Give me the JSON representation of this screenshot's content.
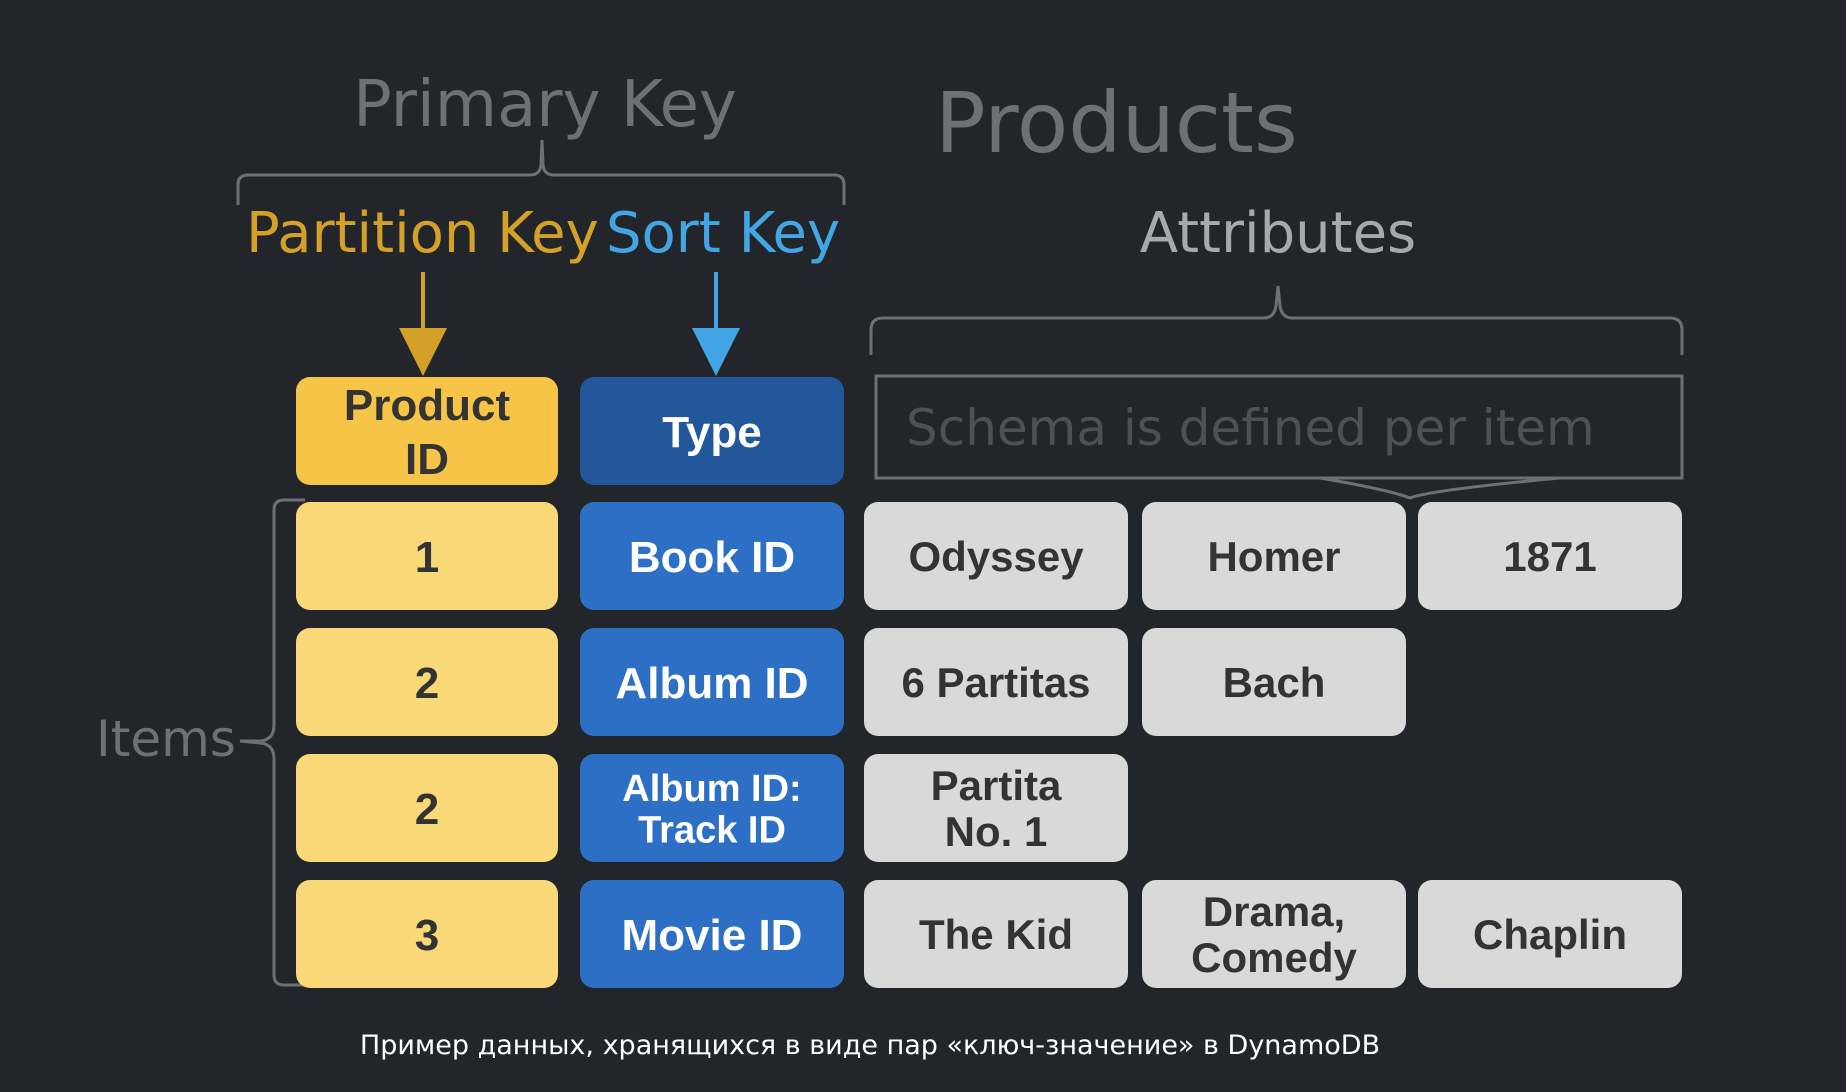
{
  "title": "Products",
  "primary_key_label": "Primary Key",
  "partition_key_label": "Partition Key",
  "sort_key_label": "Sort Key",
  "attributes_label": "Attributes",
  "items_label": "Items",
  "header": {
    "partition_line1": "Product",
    "partition_line2": "ID",
    "sort": "Type",
    "schema_note": "Schema is defined per item"
  },
  "rows": [
    {
      "partition": "1",
      "sort_lines": [
        "Book ID"
      ],
      "attributes": [
        [
          "Odyssey"
        ],
        [
          "Homer"
        ],
        [
          "1871"
        ]
      ]
    },
    {
      "partition": "2",
      "sort_lines": [
        "Album  ID"
      ],
      "attributes": [
        [
          "6 Partitas"
        ],
        [
          "Bach"
        ]
      ]
    },
    {
      "partition": "2",
      "sort_lines": [
        "Album  ID:",
        "Track ID"
      ],
      "attributes": [
        [
          "Partita",
          "No. 1"
        ]
      ]
    },
    {
      "partition": "3",
      "sort_lines": [
        "Movie ID"
      ],
      "attributes": [
        [
          "The Kid"
        ],
        [
          "Drama,",
          "Comedy"
        ],
        [
          "Chaplin"
        ]
      ]
    }
  ],
  "caption": "Пример данных, хранящихся в виде пар «ключ-значение» в DynamoDB",
  "colors": {
    "background": "#22252a",
    "partition_key": "#d3a127",
    "sort_key": "#42a5e4",
    "partition_header_fill": "#f6c548",
    "partition_cell_fill": "#f8d877",
    "sort_header_fill": "#23579b",
    "sort_cell_fill": "#2d6fc5",
    "attribute_fill": "#d9d9d9",
    "muted_text": "#6f7073",
    "attribute_label": "#a8a9ab",
    "dark_text": "#333333"
  }
}
